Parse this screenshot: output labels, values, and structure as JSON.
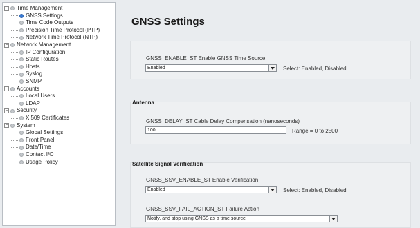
{
  "tree": [
    {
      "label": "Time Management",
      "kind": "folder"
    },
    {
      "label": "GNSS Settings",
      "kind": "leaf",
      "active": true
    },
    {
      "label": "Time Code Outputs",
      "kind": "leaf"
    },
    {
      "label": "Precision Time Protocol (PTP)",
      "kind": "leaf"
    },
    {
      "label": "Network Time Protocol (NTP)",
      "kind": "leaf"
    },
    {
      "label": "Network Management",
      "kind": "folder"
    },
    {
      "label": "IP Configuration",
      "kind": "leaf"
    },
    {
      "label": "Static Routes",
      "kind": "leaf"
    },
    {
      "label": "Hosts",
      "kind": "leaf"
    },
    {
      "label": "Syslog",
      "kind": "leaf"
    },
    {
      "label": "SNMP",
      "kind": "leaf"
    },
    {
      "label": "Accounts",
      "kind": "folder"
    },
    {
      "label": "Local Users",
      "kind": "leaf"
    },
    {
      "label": "LDAP",
      "kind": "leaf"
    },
    {
      "label": "Security",
      "kind": "folder"
    },
    {
      "label": "X.509 Certificates",
      "kind": "leaf"
    },
    {
      "label": "System",
      "kind": "folder"
    },
    {
      "label": "Global Settings",
      "kind": "leaf"
    },
    {
      "label": "Front Panel",
      "kind": "leaf"
    },
    {
      "label": "Date/Time",
      "kind": "leaf"
    },
    {
      "label": "Contact I/O",
      "kind": "leaf"
    },
    {
      "label": "Usage Policy",
      "kind": "leaf"
    }
  ],
  "page": {
    "title": "GNSS Settings"
  },
  "sections": {
    "enable": {
      "field_label": "GNSS_ENABLE_ST  Enable GNSS Time Source",
      "value": "Enabled",
      "hint": "Select: Enabled, Disabled"
    },
    "antenna": {
      "title": "Antenna",
      "field_label": "GNSS_DELAY_ST  Cable Delay Compensation (nanoseconds)",
      "value": "100",
      "hint": "Range = 0 to 2500"
    },
    "ssv": {
      "title": "Satellite Signal Verification",
      "enable_label": "GNSS_SSV_ENABLE_ST  Enable Verification",
      "enable_value": "Enabled",
      "enable_hint": "Select: Enabled, Disabled",
      "fail_label": "GNSS_SSV_FAIL_ACTION_ST  Failure Action",
      "fail_value": "Notify, and stop using GNSS as a time source"
    }
  },
  "colors": {
    "active_bullet": "#3a7bd5",
    "panel_bg": "#e9ecef"
  }
}
